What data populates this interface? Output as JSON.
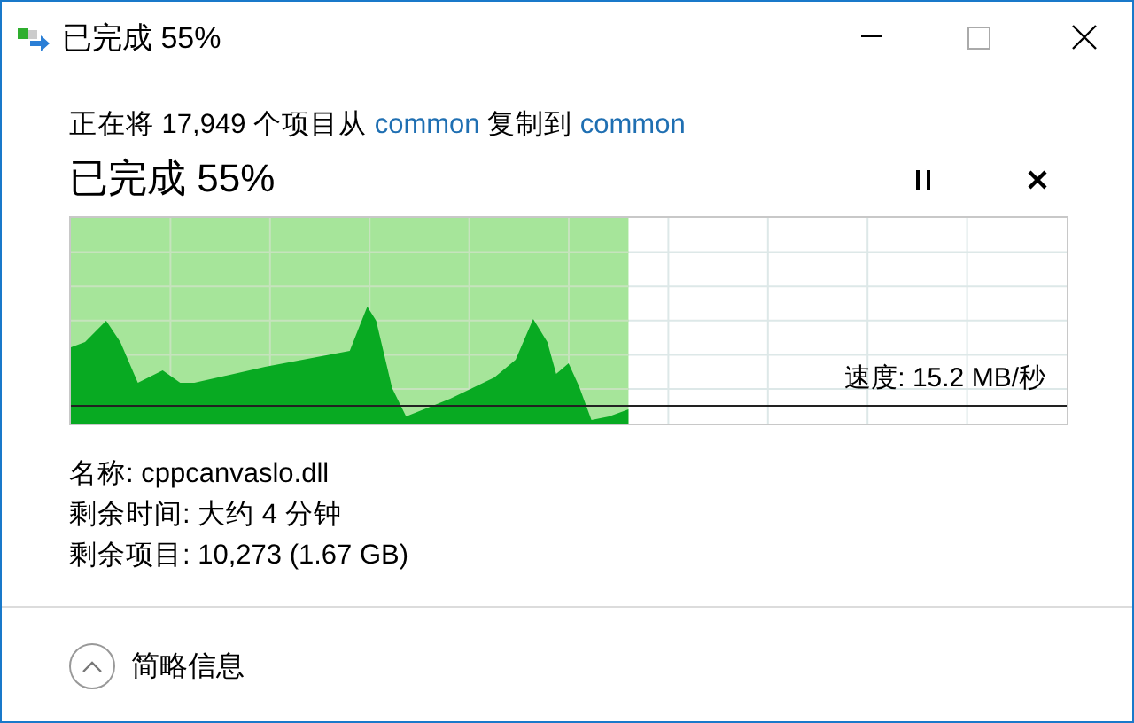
{
  "window": {
    "title": "已完成 55%"
  },
  "summary": [
    {
      "kind": "text",
      "text": "正在将 17,949 个项目从 "
    },
    {
      "kind": "link",
      "text": "common"
    },
    {
      "kind": "text",
      "text": " 复制到 "
    },
    {
      "kind": "link",
      "text": "common"
    }
  ],
  "heading": "已完成 55%",
  "progress": {
    "level": 0.56,
    "speed": "速度: 15.2 MB/秒"
  },
  "details": [
    "名称: cppcanvaslo.dll",
    "剩余时间: 大约 4 分钟",
    "剩余项目: 10,273 (1.67 GB)"
  ],
  "footer": {
    "label": "简略信息",
    "expanded": true
  }
}
